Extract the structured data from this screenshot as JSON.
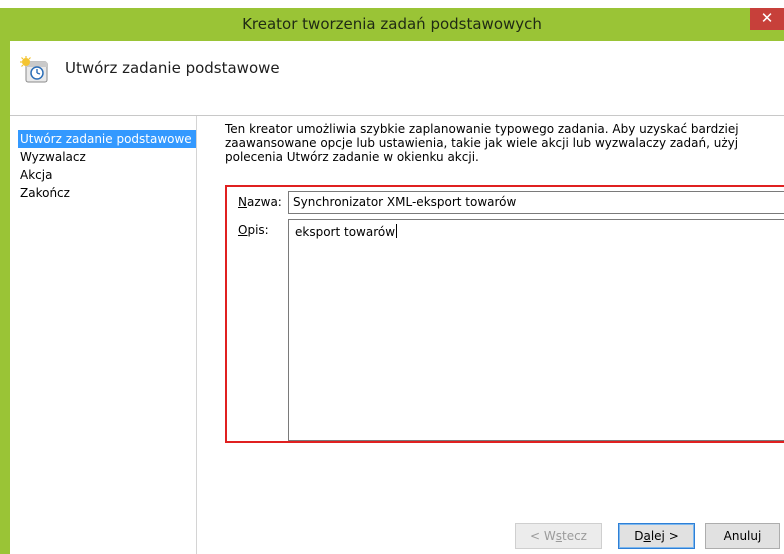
{
  "window": {
    "title": "Kreator tworzenia zadań podstawowych",
    "close_label": "✕"
  },
  "header": {
    "heading": "Utwórz zadanie podstawowe",
    "icon": "clock-task-icon"
  },
  "sidebar": {
    "items": [
      {
        "label": "Utwórz zadanie podstawowe",
        "active": true
      },
      {
        "label": "Wyzwalacz",
        "active": false
      },
      {
        "label": "Akcja",
        "active": false
      },
      {
        "label": "Zakończ",
        "active": false
      }
    ]
  },
  "main": {
    "description": "Ten kreator umożliwia szybkie zaplanowanie typowego zadania. Aby uzyskać bardziej zaawansowane opcje lub ustawienia, takie jak wiele akcji lub wyzwalaczy zadań, użyj polecenia Utwórz zadanie w okienku akcji."
  },
  "form": {
    "name_label_first": "N",
    "name_label_rest": "azwa:",
    "name_value": "Synchronizator XML-eksport towarów",
    "desc_label_first": "O",
    "desc_label_rest": "pis:",
    "desc_value": "eksport towarów",
    "highlight_color": "#e02020"
  },
  "buttons": {
    "back_label_a": "< W",
    "back_label_b": "s",
    "back_label_c": "tecz",
    "next_label_a": "D",
    "next_label_b": "a",
    "next_label_c": "lej >",
    "cancel_label": "Anuluj"
  },
  "colors": {
    "accent": "#9ac436",
    "selection": "#3399ff",
    "close": "#c7403a"
  }
}
